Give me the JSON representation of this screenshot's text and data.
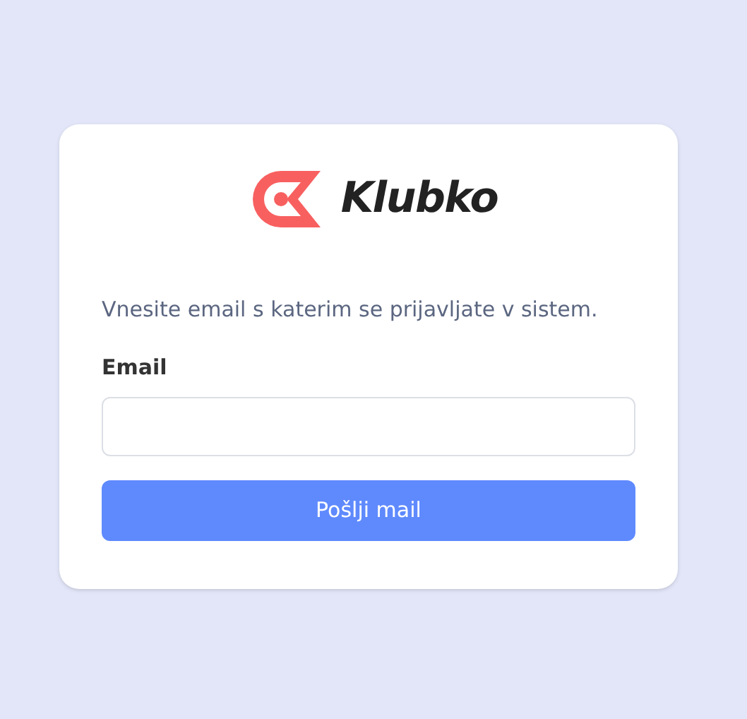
{
  "logo": {
    "text": "Klubko"
  },
  "instruction": "Vnesite email s katerim se prijavljate v sistem.",
  "email_field": {
    "label": "Email"
  },
  "submit_button": {
    "label": "Pošlji mail"
  }
}
